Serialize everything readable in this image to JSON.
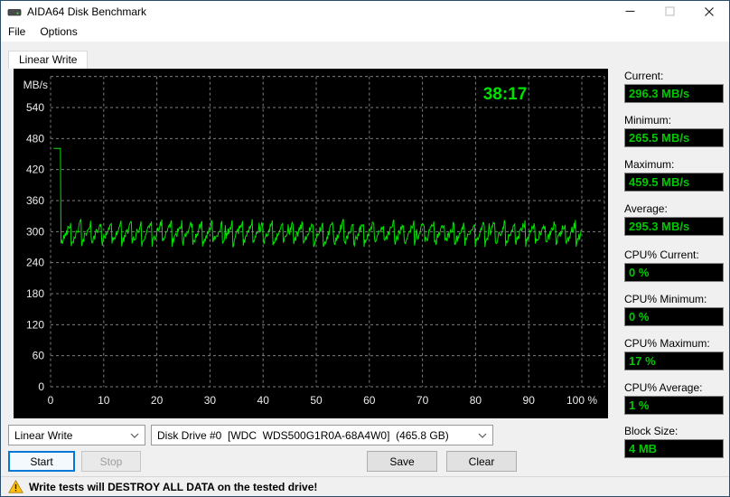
{
  "window": {
    "title": "AIDA64 Disk Benchmark"
  },
  "menu": {
    "items": [
      "File",
      "Options"
    ]
  },
  "tab": {
    "label": "Linear Write"
  },
  "icons": {
    "app": "disk-drive-icon",
    "minimize": "minimize-icon",
    "maximize": "maximize-icon",
    "close": "close-icon",
    "warning": "warning-icon",
    "combo_arrow": "chevron-down-icon"
  },
  "chart_data": {
    "type": "line",
    "timer": "38:17",
    "unit_label": "MB/s",
    "xlim": [
      0,
      100
    ],
    "ylim": [
      0,
      600
    ],
    "y_ticks": [
      0,
      60,
      120,
      180,
      240,
      300,
      360,
      420,
      480,
      540
    ],
    "x_tick_labels": [
      "0",
      "10",
      "20",
      "30",
      "40",
      "50",
      "60",
      "70",
      "80",
      "90",
      "100 %"
    ],
    "grid": true,
    "legend": "none",
    "colors": {
      "background": "#000000",
      "grid": "#7d7d7d",
      "tick_text": "#ededed",
      "line": "#00e400",
      "timer": "#00e000"
    },
    "series_summary": {
      "name": "Linear Write speed",
      "unit": "MB/s",
      "current": 296.3,
      "minimum": 265.5,
      "maximum": 459.5,
      "average": 295.3
    },
    "waveform": {
      "seed": 42,
      "start_x": 0.55,
      "plateau_value": 461,
      "plateau_end_x": 1.85,
      "drop_x": 1.95,
      "osc_base": 297,
      "osc_amp": 42,
      "osc_period": 1.9,
      "noise": 8,
      "spike_chance": 0.015,
      "spike_size": 18,
      "step": 0.13,
      "min_clamp": 267,
      "max_clamp": 338
    }
  },
  "stats": [
    {
      "label": "Current:",
      "value": "296.3 MB/s"
    },
    {
      "label": "Minimum:",
      "value": "265.5 MB/s"
    },
    {
      "label": "Maximum:",
      "value": "459.5 MB/s"
    },
    {
      "label": "Average:",
      "value": "295.3 MB/s"
    },
    {
      "label": "CPU% Current:",
      "value": "0 %"
    },
    {
      "label": "CPU% Minimum:",
      "value": "0 %"
    },
    {
      "label": "CPU% Maximum:",
      "value": "17 %"
    },
    {
      "label": "CPU% Average:",
      "value": "1 %"
    },
    {
      "label": "Block Size:",
      "value": "4 MB"
    }
  ],
  "controls": {
    "test_combo_value": "Linear Write",
    "drive_combo_value": "Disk Drive #0  [WDC  WDS500G1R0A-68A4W0]  (465.8 GB)",
    "start_label": "Start",
    "stop_label": "Stop",
    "save_label": "Save",
    "clear_label": "Clear"
  },
  "statusbar": {
    "message": "Write tests will DESTROY ALL DATA on the tested drive!"
  }
}
